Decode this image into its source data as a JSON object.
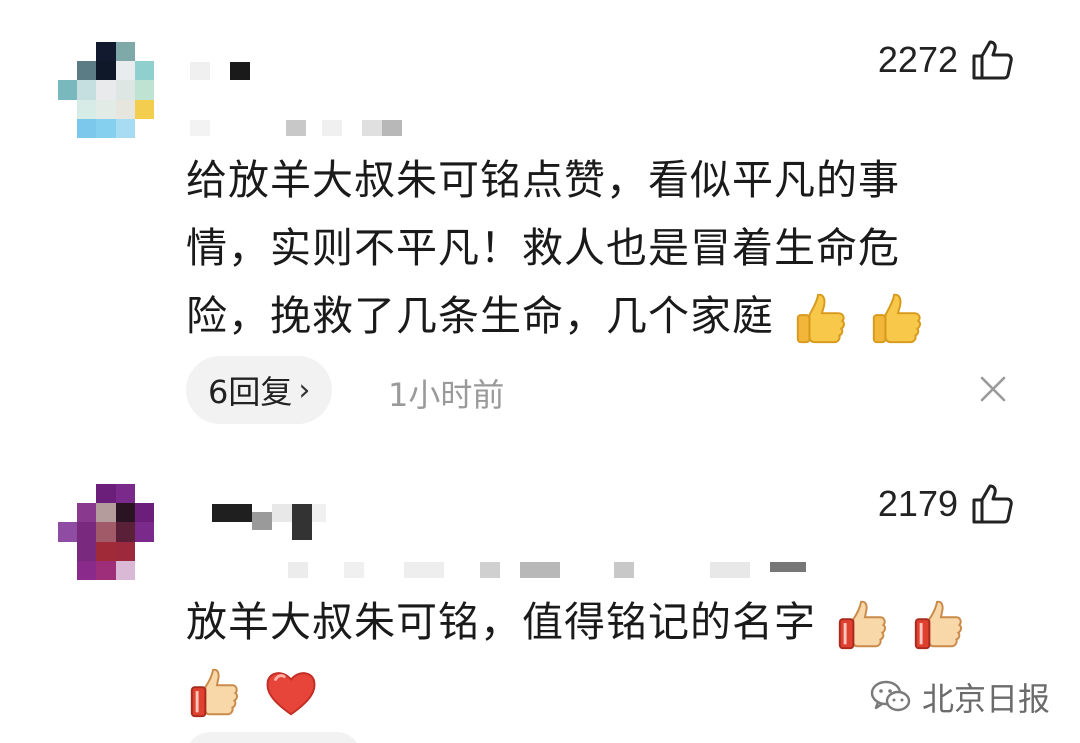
{
  "comments": [
    {
      "likes": "2272",
      "text_lines": [
        "给放羊大叔朱可铭点赞，看似平凡的事",
        "情，实则不平凡！救人也是冒着生命危",
        "险，挽救了几条生命，几个家庭"
      ],
      "emojis": [
        "thumbs-up",
        "thumbs-up"
      ],
      "replies_label": "6回复",
      "timestamp": "1小时前"
    },
    {
      "likes": "2179",
      "text_lines": [
        "放羊大叔朱可铭，值得铭记的名字"
      ],
      "emojis_line1": [
        "thumbs-up-red-cuff",
        "thumbs-up-red-cuff"
      ],
      "emojis_line2": [
        "thumbs-up-red-cuff",
        "red-heart"
      ]
    }
  ],
  "watermark": {
    "text": "北京日报"
  },
  "colors": {
    "text": "#1a1a1a",
    "muted": "#9a9a9a",
    "pill": "#f2f2f2"
  }
}
